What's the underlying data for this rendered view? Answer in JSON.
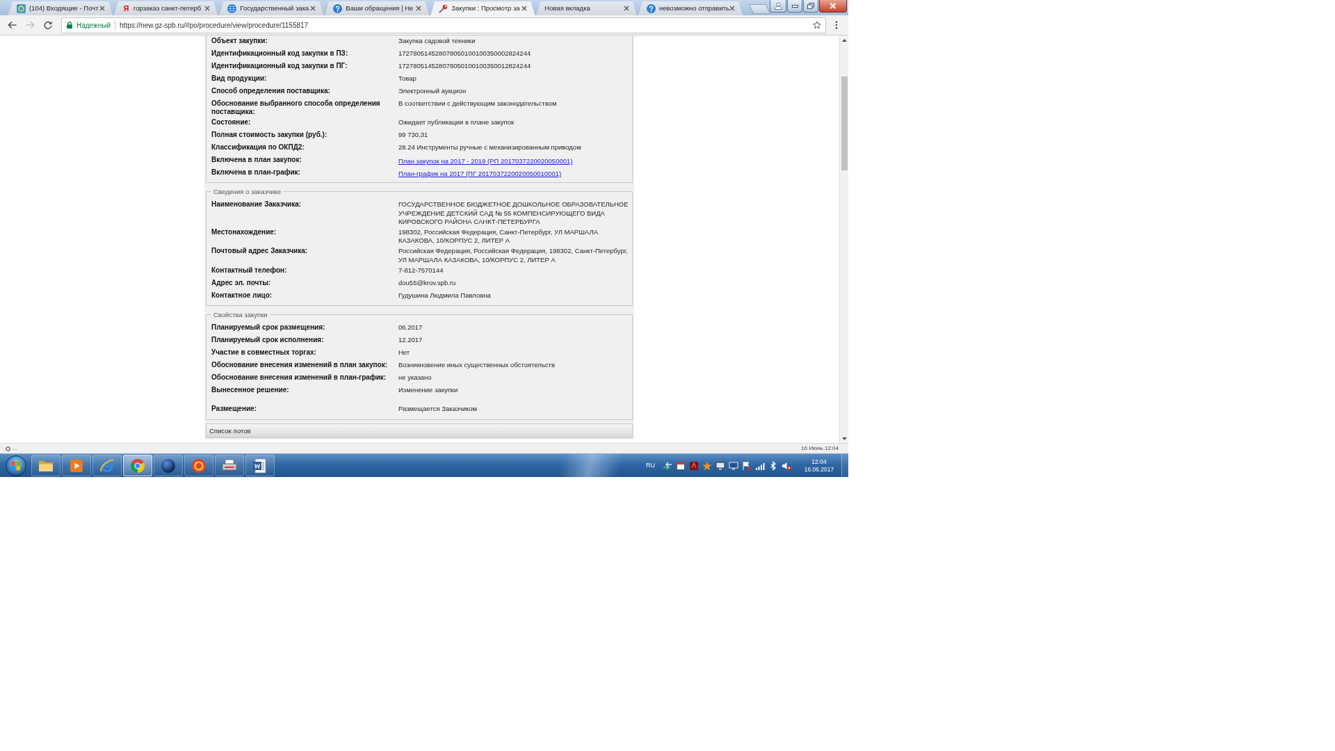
{
  "browser": {
    "tabs": [
      {
        "title": "(104) Входящие - Почт",
        "kind": "mail",
        "selected": false
      },
      {
        "title": "горзаказ санкт-петерб",
        "kind": "letter",
        "icon_glyph": "Я",
        "selected": false
      },
      {
        "title": "Государственный зака",
        "kind": "globe",
        "selected": false
      },
      {
        "title": "Ваши обращения | Не",
        "kind": "help",
        "selected": false
      },
      {
        "title": "Закупки : Просмотр за",
        "kind": "tools",
        "selected": true
      },
      {
        "title": "Новая вкладка",
        "kind": "plain",
        "selected": false
      },
      {
        "title": "невозможно отправить",
        "kind": "help",
        "selected": false
      }
    ],
    "address_bar": {
      "back_disabled": false,
      "forward_disabled": true,
      "security_label": "Надежный",
      "url": "https://new.gz-spb.ru/#po/procedure/view/procedure/1155817"
    }
  },
  "procedure": {
    "sections": [
      {
        "rows": [
          {
            "label": "Объект закупки:",
            "value": "Закупка садовой техники",
            "kind": "text"
          },
          {
            "label": "Идентификационный код закупки в ПЗ:",
            "value": "172780514528078050100100350002824244",
            "kind": "text"
          },
          {
            "label": "Идентификационный код закупки в ПГ:",
            "value": "172780514528078050100100350012824244",
            "kind": "text"
          },
          {
            "label": "Вид продукции:",
            "value": "Товар",
            "kind": "text"
          },
          {
            "label": "Способ определения поставщика:",
            "value": "Электронный аукцион",
            "kind": "text"
          },
          {
            "label": "Обоснование выбранного способа определения поставщика:",
            "value": "В соответствии с действующим законодательством",
            "kind": "text"
          },
          {
            "label": "Состояние:",
            "value": "Ожидает публикации в плане закупок",
            "kind": "text"
          },
          {
            "label": "Полная стоимость закупки (руб.):",
            "value": "99 730,31",
            "kind": "text"
          },
          {
            "label": "Классификация по ОКПД2:",
            "value": "28.24 Инструменты ручные с механизированным приводом",
            "kind": "text"
          },
          {
            "label": "Включена в план закупок:",
            "value": "План закупок на 2017 - 2019 (РП 2017037220020050001)",
            "kind": "link"
          },
          {
            "label": "Включена в план-график:",
            "value": "План-график на 2017 (ПГ 2017037220020050010001)",
            "kind": "link"
          }
        ]
      },
      {
        "legend": "Сведения о заказчике",
        "rows": [
          {
            "label": "Наименование Заказчика:",
            "value": "ГОСУДАРСТВЕННОЕ БЮДЖЕТНОЕ ДОШКОЛЬНОЕ ОБРАЗОВАТЕЛЬНОЕ УЧРЕЖДЕНИЕ ДЕТСКИЙ САД № 55 КОМПЕНСИРУЮЩЕГО ВИДА КИРОВСКОГО РАЙОНА САНКТ-ПЕТЕРБУРГА",
            "kind": "text"
          },
          {
            "label": "Местонахождение:",
            "value": "198302, Российская Федерация, Санкт-Петербург, УЛ МАРШАЛА КАЗАКОВА, 10/КОРПУС 2, ЛИТЕР А",
            "kind": "text"
          },
          {
            "label": "Почтовый адрес Заказчика:",
            "value": "Российская Федерация, Российская Федерация, 198302, Санкт-Петербург, УЛ МАРШАЛА КАЗАКОВА, 10/КОРПУС 2, ЛИТЕР А",
            "kind": "text"
          },
          {
            "label": "Контактный телефон:",
            "value": "7-812-7570144",
            "kind": "text"
          },
          {
            "label": "Адрес эл. почты:",
            "value": "dou55@krov.spb.ru",
            "kind": "text"
          },
          {
            "label": "Контактное лицо:",
            "value": "Гудушина Людмила Павловна",
            "kind": "text"
          }
        ]
      },
      {
        "legend": "Свойства закупки",
        "rows": [
          {
            "label": "Планируемый срок размещения:",
            "value": "06.2017",
            "kind": "text"
          },
          {
            "label": "Планируемый срок исполнения:",
            "value": "12.2017",
            "kind": "text"
          },
          {
            "label": "Участие в совместных торгах:",
            "value": "Нет",
            "kind": "text"
          },
          {
            "label": "Обоснование внесения изменений в план закупок:",
            "value": "Возникновение иных существенных обстоятельств",
            "kind": "text"
          },
          {
            "label": "Обоснование внесения изменений в план-график:",
            "value": "не указано",
            "kind": "text"
          },
          {
            "label": "Вынесенное решение:",
            "value": "Изменение закупки",
            "kind": "text"
          },
          {
            "label": "Размещение:",
            "value": "Размещается Заказчиком",
            "kind": "text"
          }
        ]
      }
    ],
    "lots": {
      "title": "Список лотов"
    }
  },
  "status_bar": {
    "left": "...",
    "right": "16 Июнь 12:04"
  },
  "taskbar": {
    "pinned": [
      {
        "kind": "folder",
        "selected": false
      },
      {
        "kind": "player",
        "selected": false
      },
      {
        "kind": "orbit",
        "selected": false
      },
      {
        "kind": "wheel",
        "selected": true
      },
      {
        "kind": "sphere",
        "selected": false
      },
      {
        "kind": "disc",
        "selected": false
      },
      {
        "kind": "printer",
        "selected": false
      },
      {
        "kind": "document",
        "selected": false
      }
    ],
    "language": "RU",
    "clock": {
      "time": "12:04",
      "date": "16.06.2017"
    }
  }
}
